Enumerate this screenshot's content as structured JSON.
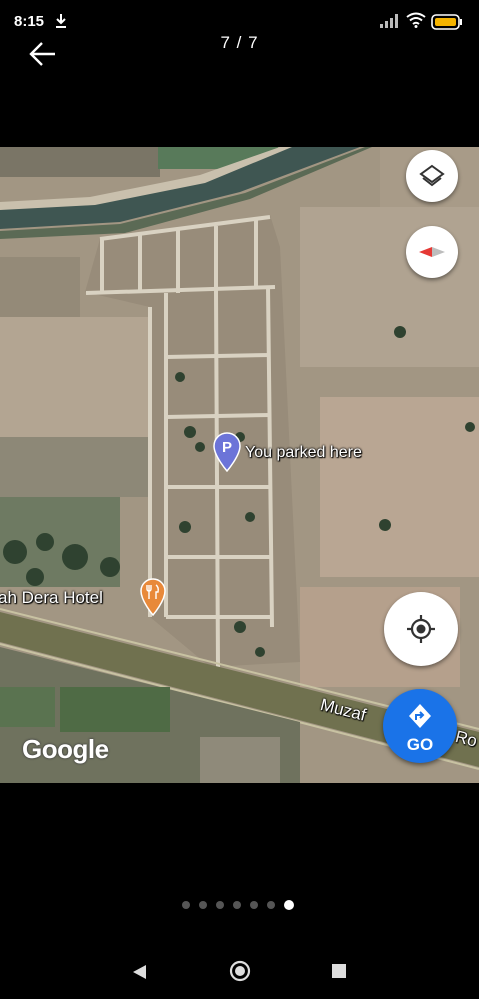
{
  "status_bar": {
    "time": "8:15",
    "icons": [
      "download-icon",
      "signal-icon",
      "wifi-icon",
      "battery-icon"
    ]
  },
  "header": {
    "counter": "7 / 7",
    "back_icon": "arrow-left-icon"
  },
  "map": {
    "parked_label": "You parked here",
    "hotel_label": "ah Dera Hotel",
    "road_label": "Muzaf",
    "road_label_tail": "Ro",
    "attribution": "Google",
    "controls": {
      "layers_icon": "layers-icon",
      "compass_icon": "compass-icon",
      "locate_icon": "my-location-icon"
    },
    "go_button": {
      "label": "GO",
      "icon": "directions-icon"
    },
    "colors": {
      "go_blue": "#1a73e8",
      "pin_purple": "#6c74d8",
      "food_orange": "#e8893a"
    }
  },
  "pager": {
    "total": 7,
    "active": 7
  },
  "nav_bar": {
    "icons": [
      "back-triangle-icon",
      "home-circle-icon",
      "recents-square-icon"
    ]
  }
}
